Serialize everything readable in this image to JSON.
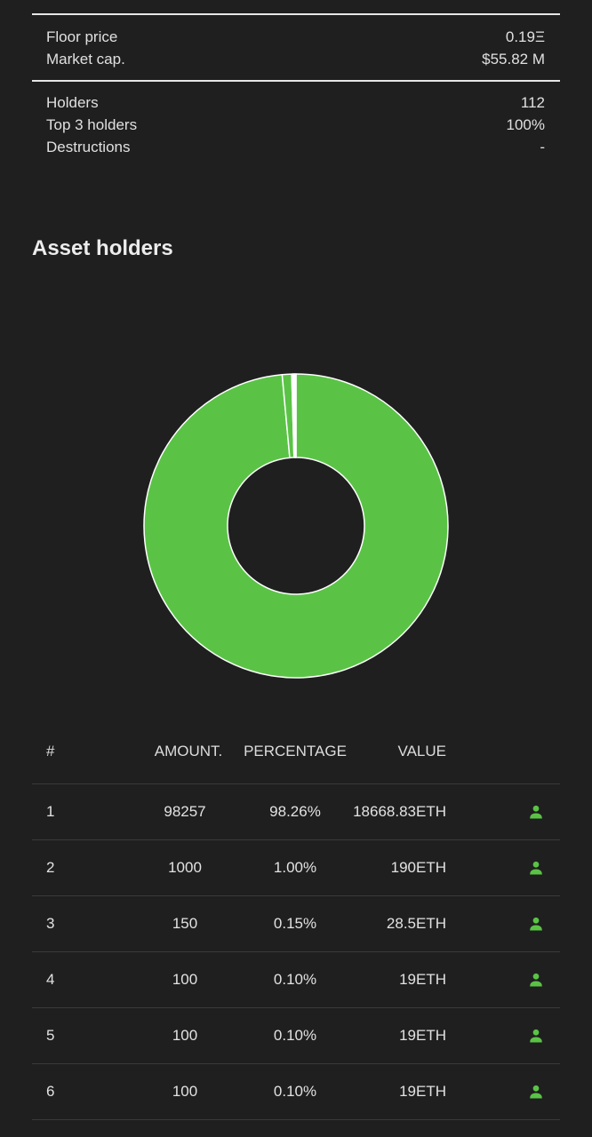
{
  "market_stats": [
    {
      "label": "Floor price",
      "value": "0.19Ξ"
    },
    {
      "label": "Market cap.",
      "value": "$55.82 M"
    }
  ],
  "holder_stats": [
    {
      "label": "Holders",
      "value": "112"
    },
    {
      "label": "Top 3 holders",
      "value": "100%"
    },
    {
      "label": "Destructions",
      "value": "-"
    }
  ],
  "section_title": "Asset holders",
  "chart_data": {
    "type": "pie",
    "variant": "donut",
    "slices": [
      {
        "rank": "1",
        "value": 98257,
        "percent": 98.26,
        "color": "#5ac346"
      },
      {
        "rank": "2",
        "value": 1000,
        "percent": 1.0,
        "color": "#5ac346"
      },
      {
        "rank": "3",
        "value": 150,
        "percent": 0.15,
        "color": "#ffffff"
      },
      {
        "rank": "4",
        "value": 100,
        "percent": 0.1,
        "color": "#ffffff"
      },
      {
        "rank": "5",
        "value": 100,
        "percent": 0.1,
        "color": "#ffffff"
      },
      {
        "rank": "6",
        "value": 100,
        "percent": 0.1,
        "color": "#ffffff"
      }
    ],
    "stroke_color": "#ffffff"
  },
  "table": {
    "headers": {
      "rank": "#",
      "amount": "AMOUNT.",
      "percentage": "PERCENTAGE",
      "value": "VALUE"
    },
    "rows": [
      {
        "rank": "1",
        "amount": "98257",
        "percentage": "98.26%",
        "value": "18668.83ETH",
        "icon": "user-icon"
      },
      {
        "rank": "2",
        "amount": "1000",
        "percentage": "1.00%",
        "value": "190ETH",
        "icon": "user-icon"
      },
      {
        "rank": "3",
        "amount": "150",
        "percentage": "0.15%",
        "value": "28.5ETH",
        "icon": "user-icon"
      },
      {
        "rank": "4",
        "amount": "100",
        "percentage": "0.10%",
        "value": "19ETH",
        "icon": "user-icon"
      },
      {
        "rank": "5",
        "amount": "100",
        "percentage": "0.10%",
        "value": "19ETH",
        "icon": "user-icon"
      },
      {
        "rank": "6",
        "amount": "100",
        "percentage": "0.10%",
        "value": "19ETH",
        "icon": "user-icon"
      }
    ]
  },
  "colors": {
    "accent": "#5ac346",
    "background": "#1f1f1f",
    "divider": "#e6e6e6"
  }
}
